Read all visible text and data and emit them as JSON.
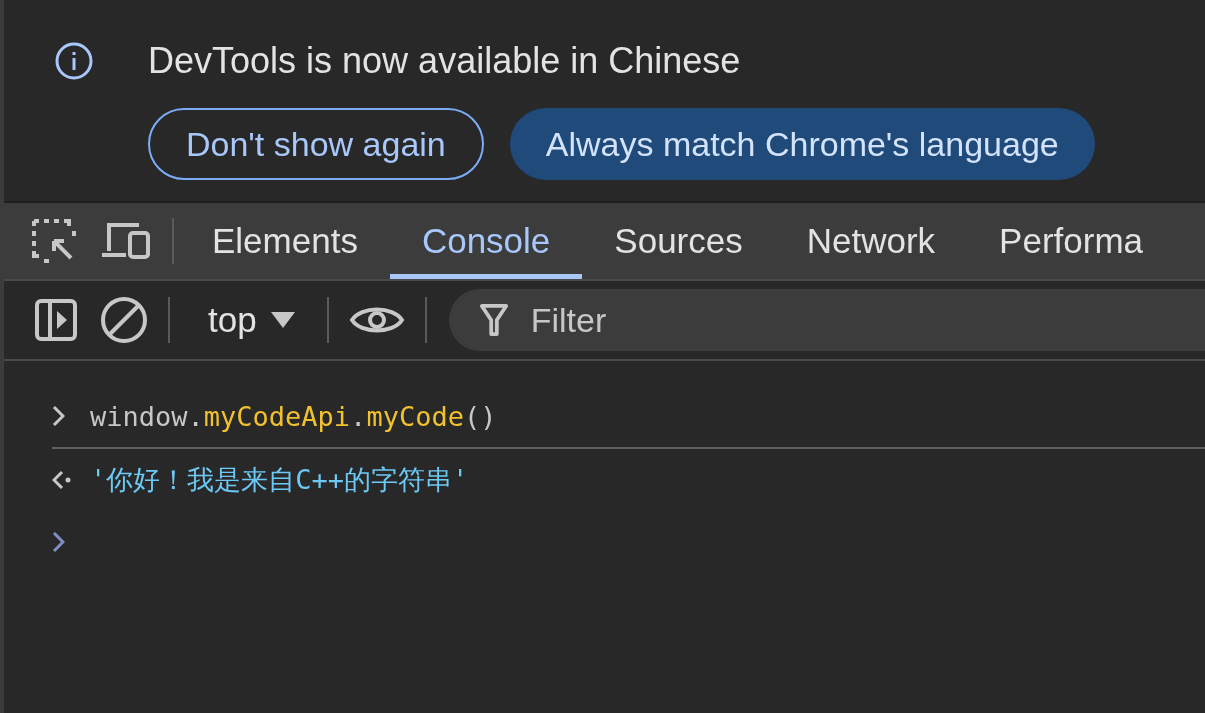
{
  "infobar": {
    "message": "DevTools is now available in Chinese",
    "buttons": [
      {
        "label": "Don't show again",
        "kind": "outline"
      },
      {
        "label": "Always match Chrome's language",
        "kind": "primary"
      }
    ]
  },
  "tabs": [
    {
      "label": "Elements",
      "selected": false
    },
    {
      "label": "Console",
      "selected": true
    },
    {
      "label": "Sources",
      "selected": false
    },
    {
      "label": "Network",
      "selected": false
    },
    {
      "label": "Performa",
      "selected": false
    }
  ],
  "console_toolbar": {
    "context": "top",
    "filter": {
      "placeholder": "Filter"
    }
  },
  "console": [
    {
      "kind": "input",
      "tokens": [
        {
          "text": "window.",
          "kind": "plain"
        },
        {
          "text": "myCodeApi",
          "kind": "member"
        },
        {
          "text": ".",
          "kind": "plain"
        },
        {
          "text": "myCode",
          "kind": "member"
        },
        {
          "text": "()",
          "kind": "plain"
        }
      ]
    },
    {
      "kind": "result",
      "tokens": [
        {
          "text": "'你好！我是来自C++的字符串'",
          "kind": "string"
        }
      ]
    },
    {
      "kind": "prompt"
    }
  ]
}
